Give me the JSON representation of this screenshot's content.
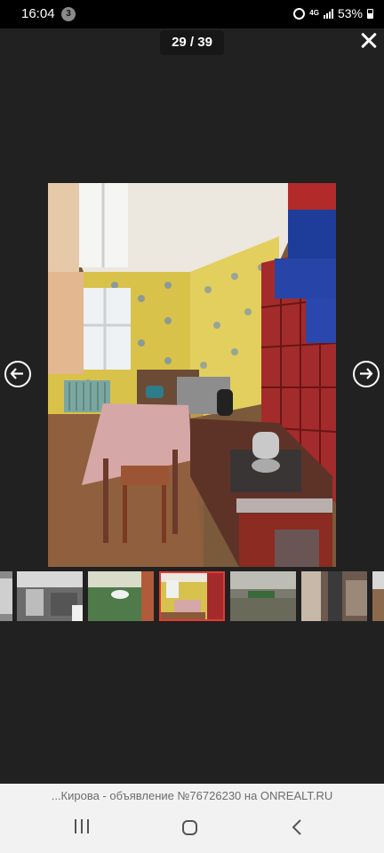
{
  "status_bar": {
    "time": "16:04",
    "notification_count": "3",
    "network": "4G",
    "battery": "53%",
    "icons": [
      "alarm-icon",
      "signal-icon",
      "battery-icon"
    ]
  },
  "viewer": {
    "counter": "29 / 39",
    "close_icon": "close-icon",
    "prev_icon": "arrow-left-circle-icon",
    "next_icon": "arrow-right-circle-icon",
    "current_photo": "kitchen-interior-photo"
  },
  "thumbnails": [
    {
      "name": "thumb-partial"
    },
    {
      "name": "thumb-kitchen-stove"
    },
    {
      "name": "thumb-green-room"
    },
    {
      "name": "thumb-current",
      "active": true
    },
    {
      "name": "thumb-yard"
    },
    {
      "name": "thumb-hallway"
    },
    {
      "name": "thumb-partial-right"
    }
  ],
  "footer": {
    "source": "...Кирова - объявление №76726230 на ONREALT.RU"
  },
  "colors": {
    "background": "#212121",
    "active_thumb_border": "#e53935"
  }
}
